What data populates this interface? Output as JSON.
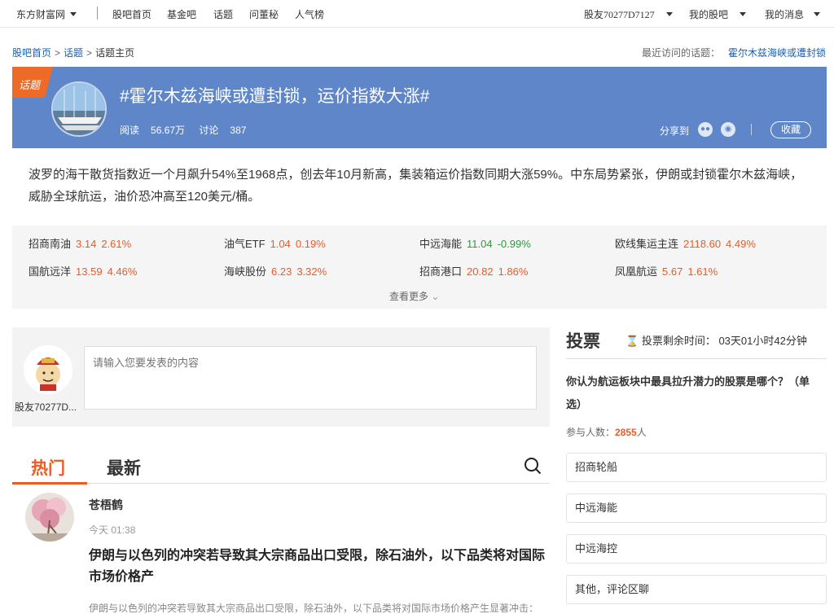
{
  "topnav": {
    "logo": "东方财富网",
    "links": [
      "股吧首页",
      "基金吧",
      "话题",
      "问董秘",
      "人气榜"
    ],
    "user": "股友70277D7127",
    "my_stocks": "我的股吧",
    "my_messages": "我的消息"
  },
  "breadcrumb": {
    "items": [
      "股吧首页",
      "话题",
      "话题主页"
    ],
    "recent_label": "最近访问的话题：",
    "recent_topic": "霍尔木兹海峡或遭封锁"
  },
  "banner": {
    "tag": "话题",
    "title": "#霍尔木兹海峡或遭封锁，运价指数大涨#",
    "reads_label": "阅读",
    "reads": "56.67万",
    "comments_label": "讨论",
    "comments": "387",
    "share_label": "分享到",
    "favorite_label": "收藏"
  },
  "description": "波罗的海干散货指数近一个月飙升54%至1968点，创去年10月新高，集装箱运价指数同期大涨59%。中东局势紧张，伊朗或封锁霍尔木兹海峡，威胁全球航运，油价恐冲高至120美元/桶。",
  "stocks": [
    {
      "name": "招商南油",
      "price": "3.14",
      "change": "2.61%",
      "dir": "up"
    },
    {
      "name": "油气ETF",
      "price": "1.04",
      "change": "0.19%",
      "dir": "up"
    },
    {
      "name": "中远海能",
      "price": "11.04",
      "change": "-0.99%",
      "dir": "down"
    },
    {
      "name": "欧线集运主连",
      "price": "2118.60",
      "change": "4.49%",
      "dir": "up"
    },
    {
      "name": "国航远洋",
      "price": "13.59",
      "change": "4.46%",
      "dir": "up"
    },
    {
      "name": "海峡股份",
      "price": "6.23",
      "change": "3.32%",
      "dir": "up"
    },
    {
      "name": "招商港口",
      "price": "20.82",
      "change": "1.86%",
      "dir": "up"
    },
    {
      "name": "凤凰航运",
      "price": "5.67",
      "change": "1.61%",
      "dir": "up"
    }
  ],
  "stocks_more": "查看更多",
  "post": {
    "username": "股友70277D...",
    "placeholder": "请输入您要发表的内容"
  },
  "tabs": {
    "hot": "热门",
    "latest": "最新"
  },
  "feed": {
    "author": "苍梧鹤",
    "time": "今天 01:38",
    "title": "伊朗与以色列的冲突若导致其大宗商品出口受限，除石油外，以下品类将对国际市场价格产",
    "snippet": "伊朗与以色列的冲突若导致其大宗商品出口受限，除石油外，以下品类将对国际市场价格产生显著冲击："
  },
  "vote": {
    "heading": "投票",
    "time_label": "投票剩余时间：",
    "time_value": "03天01小时42分钟",
    "question": "你认为航运板块中最具拉升潜力的股票是哪个？（单选）",
    "participants_label": "参与人数：",
    "participants": "2855",
    "participants_unit": "人",
    "options": [
      "招商轮船",
      "中远海能",
      "中远海控",
      "其他，评论区聊"
    ]
  },
  "colors": {
    "accent": "#ee5a24",
    "banner": "#5e86c9",
    "up": "#ee5a24",
    "down": "#2d9b3a",
    "link": "#1a5fb4"
  }
}
